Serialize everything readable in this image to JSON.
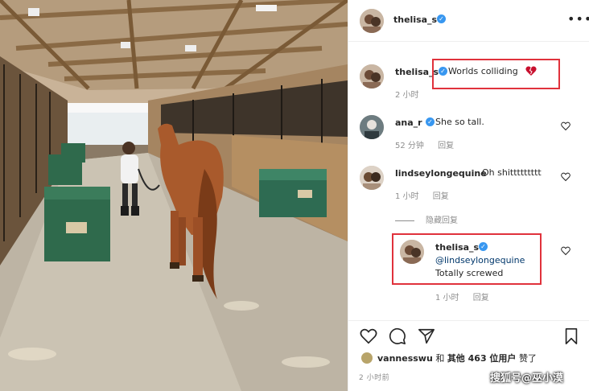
{
  "header": {
    "username": "thelisa_s",
    "verified_icon": "verified-badge-icon",
    "more_icon": "more-options-icon"
  },
  "caption": {
    "username": "thelisa_s",
    "text": "Worlds colliding",
    "emoji": "broken-heart-icon",
    "time": "2 小时"
  },
  "comments": [
    {
      "username": "ana_r",
      "verified": true,
      "text": "She so tall.",
      "time": "52 分钟",
      "reply": "回复"
    },
    {
      "username": "lindseylongequine",
      "verified": false,
      "text": "Oh shittttttttt",
      "time": "1 小时",
      "reply": "回复"
    }
  ],
  "hide_replies": "隐藏回复",
  "reply": {
    "username": "thelisa_s",
    "mention": "@lindseylongequine",
    "text": "Totally screwed",
    "time": "1 小时",
    "reply": "回复"
  },
  "likes": {
    "user": "vannesswu",
    "middle": "和",
    "others": "其他 463 位用户",
    "suffix": "赞了"
  },
  "post_time": "2 小时前",
  "watermark": "搜狐号@巫小漠",
  "colors": {
    "accent": "#3897f0",
    "highlight_box": "#e0323c",
    "meta_text": "#8e8e8e"
  }
}
